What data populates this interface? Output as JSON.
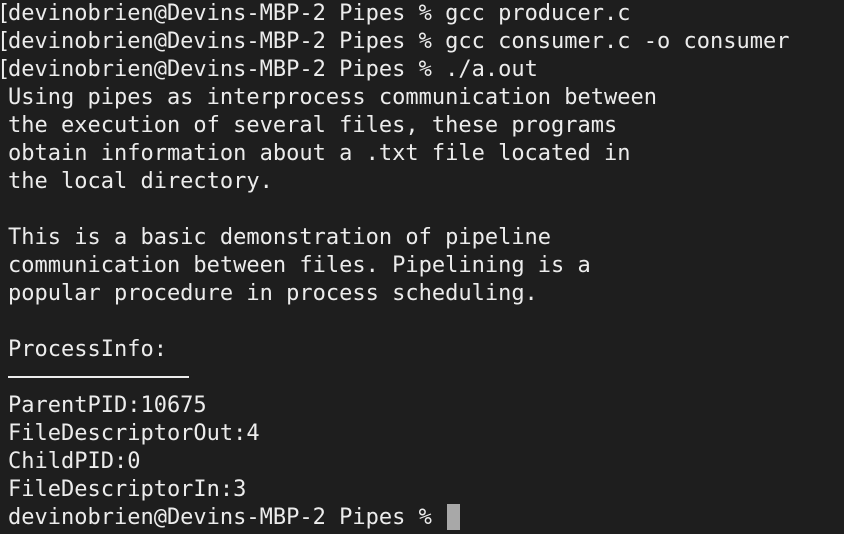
{
  "session": {
    "commands": [
      {
        "prompt": "devinobrien@Devins-MBP-2 Pipes % ",
        "command": "gcc producer.c"
      },
      {
        "prompt": "devinobrien@Devins-MBP-2 Pipes % ",
        "command": "gcc consumer.c -o consumer"
      },
      {
        "prompt": "devinobrien@Devins-MBP-2 Pipes % ",
        "command": "./a.out"
      }
    ],
    "output_paragraph_1": [
      "Using pipes as interprocess communication between",
      "the execution of several files, these programs",
      "obtain information about a .txt file located in",
      "the local directory."
    ],
    "output_paragraph_2": [
      "This is a basic demonstration of pipeline",
      "communication between files. Pipelining is a",
      "popular procedure in process scheduling."
    ],
    "process_info_header": "ProcessInfo:",
    "process_info": [
      "ParentPID:10675",
      "FileDescriptorOut:4",
      "ChildPID:0",
      "FileDescriptorIn:3"
    ],
    "final_prompt": "devinobrien@Devins-MBP-2 Pipes % "
  }
}
